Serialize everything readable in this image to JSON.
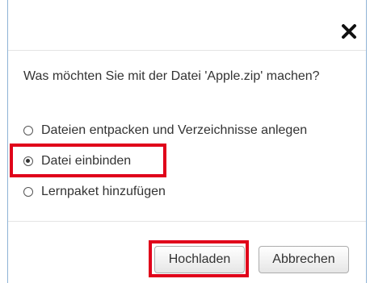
{
  "dialog": {
    "question": "Was möchten Sie mit der Datei 'Apple.zip' machen?",
    "options": [
      {
        "label": "Dateien entpacken und Verzeichnisse anlegen",
        "checked": false
      },
      {
        "label": "Datei einbinden",
        "checked": true
      },
      {
        "label": "Lernpaket hinzufügen",
        "checked": false
      }
    ],
    "buttons": {
      "upload_label": "Hochladen",
      "cancel_label": "Abbrechen"
    },
    "icons": {
      "close": "close-icon"
    },
    "colors": {
      "highlight": "#e0001a",
      "border": "#8fb3d6"
    }
  }
}
